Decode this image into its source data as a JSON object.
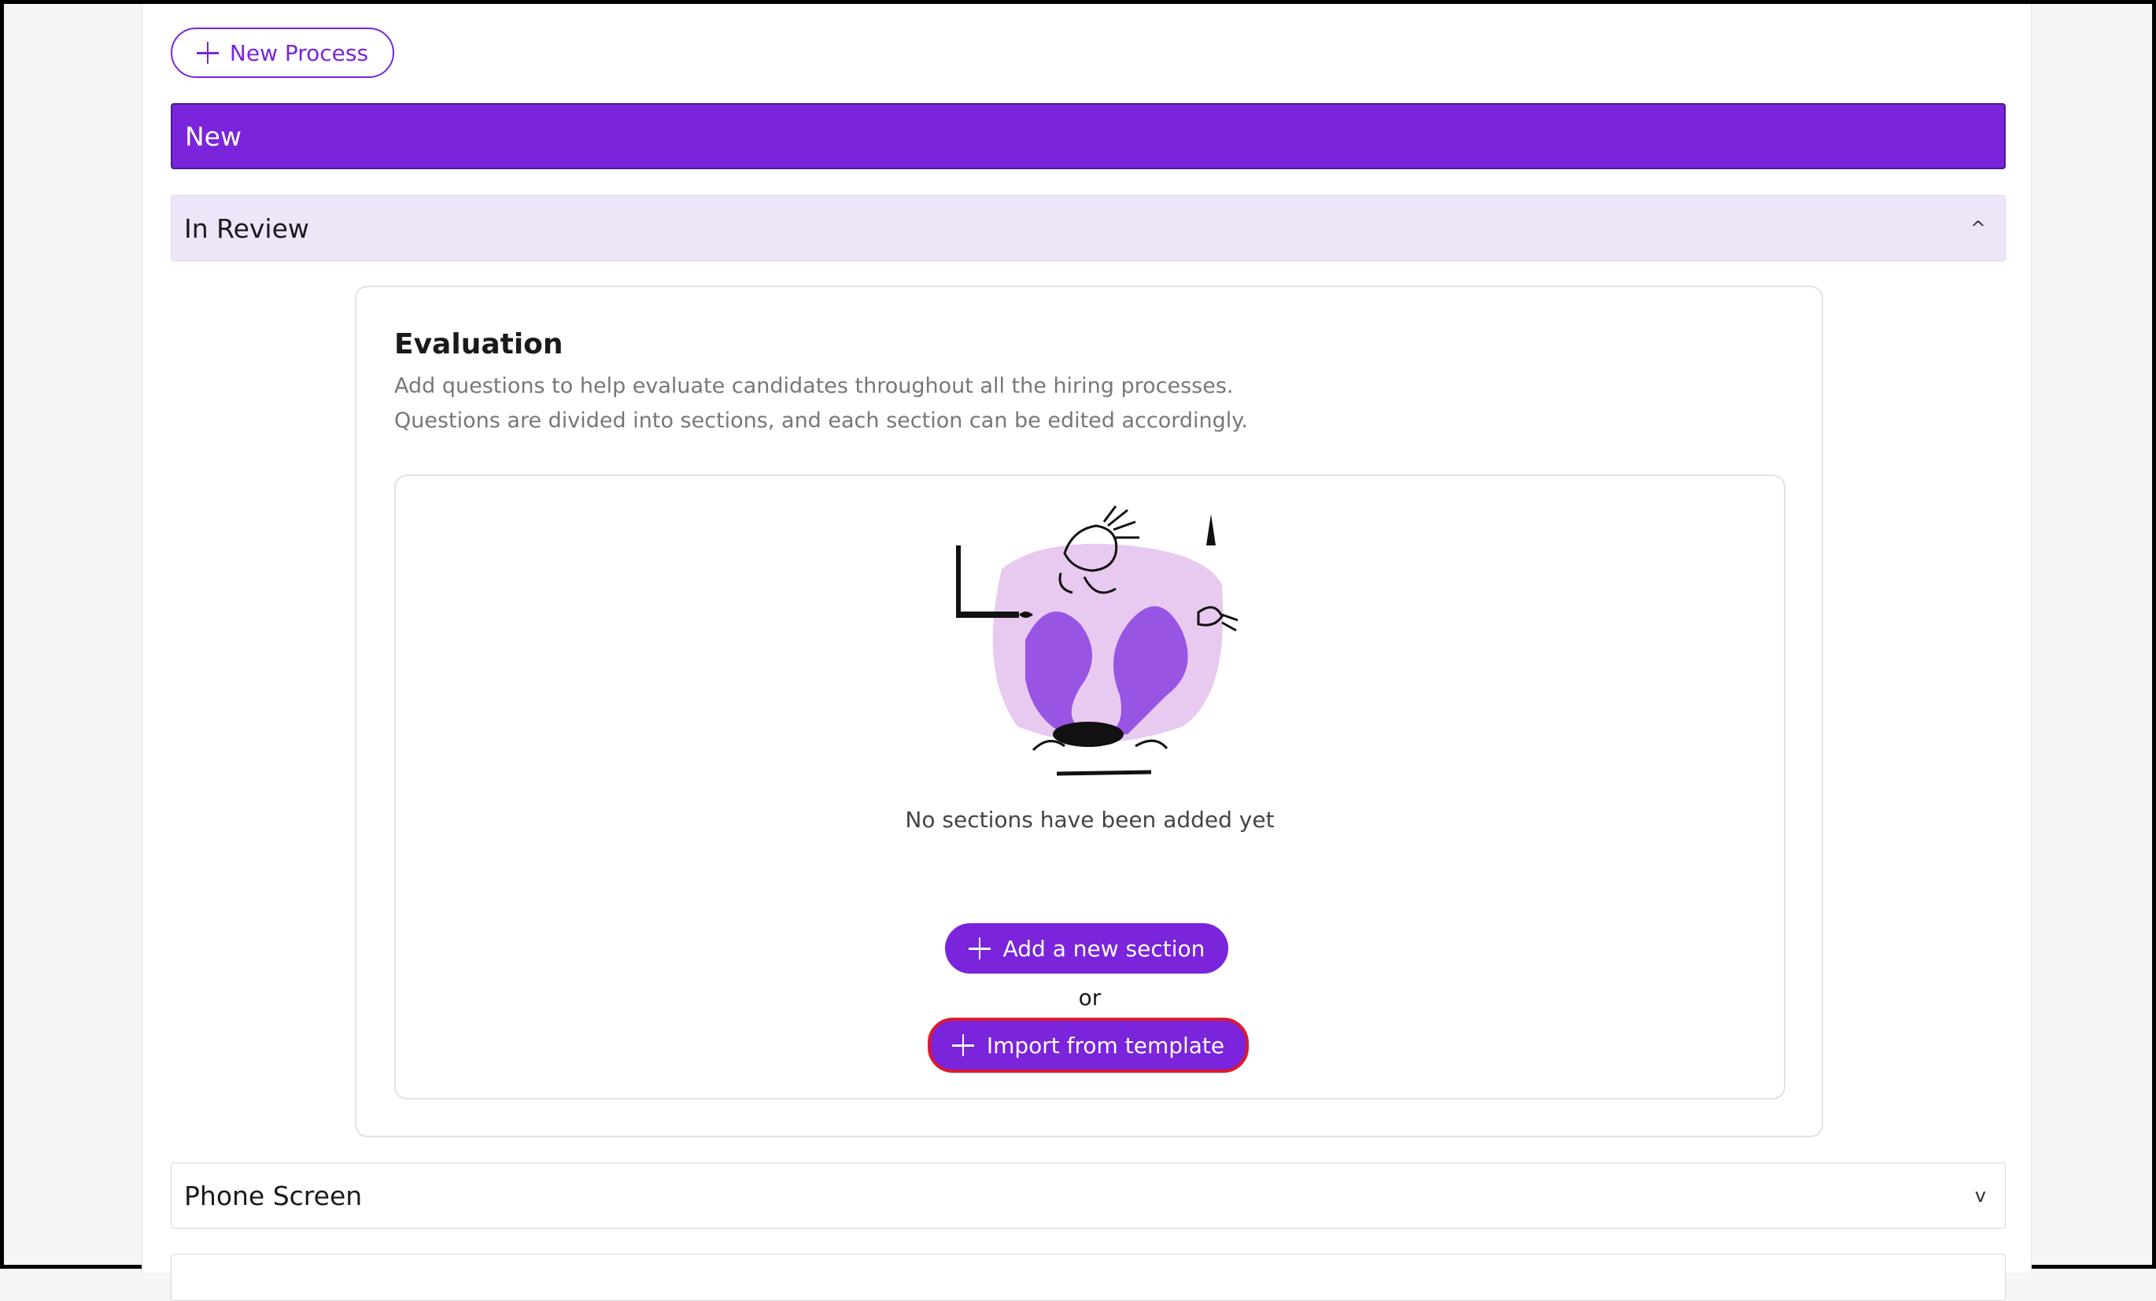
{
  "toolbar": {
    "new_process_label": "New Process"
  },
  "stages": {
    "new": {
      "label": "New"
    },
    "in_review": {
      "label": "In Review",
      "chevron": "^"
    },
    "phone_screen": {
      "label": "Phone Screen",
      "chevron": "v"
    }
  },
  "evaluation": {
    "title": "Evaluation",
    "description_line1": "Add questions to help evaluate candidates throughout all the hiring processes.",
    "description_line2": "Questions are divided into sections, and each section can be edited accordingly.",
    "empty_text": "No sections have been added yet",
    "add_section_label": "Add a new section",
    "or_label": "or",
    "import_label": "Import from template"
  },
  "colors": {
    "accent": "#7a24db",
    "highlight_border": "#e0182d",
    "review_bg": "#efe5f8"
  },
  "icons": [
    "plus-icon",
    "chevron-up-icon",
    "chevron-down-icon",
    "empty-state-illustration"
  ]
}
